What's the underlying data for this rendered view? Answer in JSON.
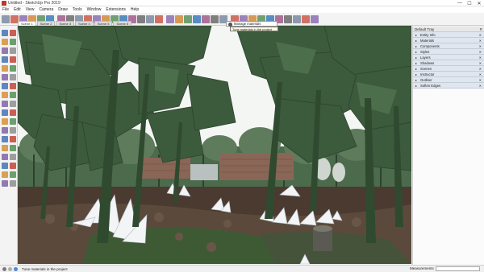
{
  "window": {
    "title": "Untitled - SketchUp Pro 2019",
    "controls": [
      "—",
      "☐",
      "✕"
    ]
  },
  "menu": [
    "File",
    "Edit",
    "View",
    "Camera",
    "Draw",
    "Tools",
    "Window",
    "Extensions",
    "Help"
  ],
  "toolbar_icons": [
    "select-icon",
    "eraser-icon",
    "paint-icon",
    "line-icon",
    "arc-icon",
    "rectangle-icon",
    "circle-icon",
    "push-pull-icon",
    "move-icon",
    "rotate-icon",
    "scale-icon",
    "offset-icon",
    "follow-me-icon",
    "tape-icon",
    "dimension-icon",
    "protractor-icon",
    "text-icon",
    "axes-icon",
    "section-icon",
    "orbit-icon",
    "pan-icon",
    "zoom-icon",
    "zoom-extents-icon",
    "previous-icon",
    "walk-icon",
    "look-icon",
    "position-camera-icon",
    "warehouse-icon",
    "extension-icon",
    "styles-icon",
    "shadow-icon",
    "materials-icon",
    "info-icon",
    "mail-icon",
    "cart-icon"
  ],
  "tooltip": {
    "title": "Manage materials",
    "body": "Tune materials in the project"
  },
  "scene_tabs": [
    "Scene 1",
    "Scene 2",
    "Scene 3",
    "Scene 4",
    "Scene 5",
    "Scene 6"
  ],
  "tray": {
    "title": "Default Tray",
    "close": "✕",
    "panels": [
      "Entity Info",
      "Materials",
      "Components",
      "Styles",
      "Layers",
      "Shadows",
      "Scenes",
      "Instructor",
      "Outliner",
      "Soften Edges"
    ]
  },
  "status": {
    "text": "Tune materials in the project",
    "measurements_label": "Measurements"
  },
  "colors": {
    "sky": "#f4f6f4",
    "foliage": "#3c5a3c",
    "ground": "#4a3a30",
    "crystal": "#f2f4f6",
    "tray_panel": "#dfe6ef"
  }
}
